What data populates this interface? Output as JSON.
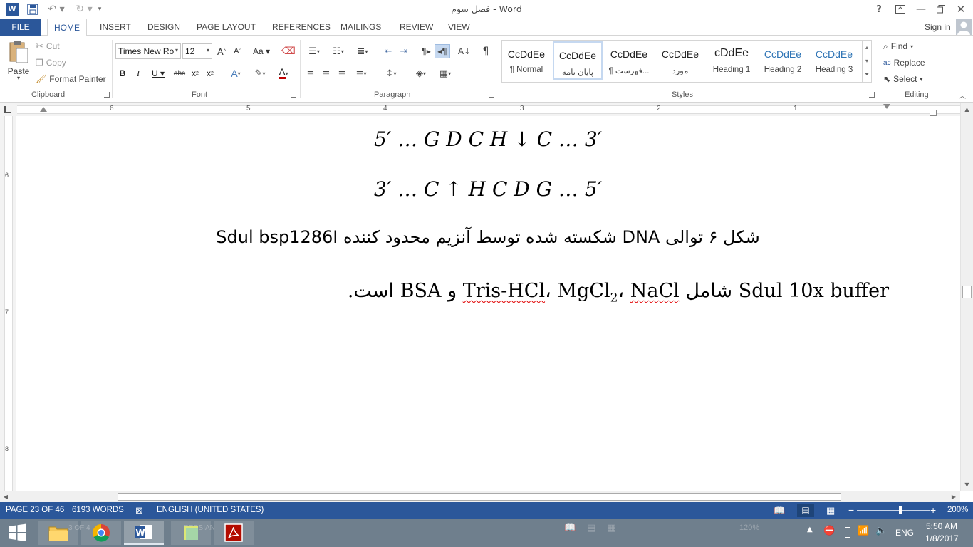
{
  "titlebar": {
    "title": "فصل سوم - Word",
    "help": "?",
    "signin": "Sign in"
  },
  "tabs": [
    "FILE",
    "HOME",
    "INSERT",
    "DESIGN",
    "PAGE LAYOUT",
    "REFERENCES",
    "MAILINGS",
    "REVIEW",
    "VIEW"
  ],
  "clipboard": {
    "paste": "Paste",
    "cut": "Cut",
    "copy": "Copy",
    "format_painter": "Format Painter",
    "label": "Clipboard"
  },
  "font": {
    "name": "Times New Ro",
    "size": "12",
    "label": "Font"
  },
  "paragraph": {
    "label": "Paragraph"
  },
  "styles": {
    "label": "Styles",
    "items": [
      {
        "sample": "CcDdEe",
        "name": "¶ Normal",
        "color": "#222"
      },
      {
        "sample": "CcDdEe",
        "name": "پایان نامه",
        "color": "#222"
      },
      {
        "sample": "CcDdEe",
        "name": "¶ فهرست...",
        "color": "#222"
      },
      {
        "sample": "CcDdEe",
        "name": "مورد",
        "color": "#222"
      },
      {
        "sample": "cDdEe",
        "name": "Heading 1",
        "color": "#222"
      },
      {
        "sample": "CcDdEe",
        "name": "Heading 2",
        "color": "#2e74b5"
      },
      {
        "sample": "CcDdEe",
        "name": "Heading 3",
        "color": "#2e74b5"
      }
    ]
  },
  "editing": {
    "find": "Find",
    "replace": "Replace",
    "select": "Select",
    "label": "Editing"
  },
  "ruler": {
    "numbers": [
      "6",
      "5",
      "4",
      "3",
      "2",
      "1"
    ],
    "vnumbers": [
      "6",
      "7",
      "8"
    ]
  },
  "document": {
    "eq1": "5′ … G D C H ↓ C … 3′",
    "eq2": "3′ … C ↑ H C D G … 5′",
    "caption": "شکل ۶ توالی DNA شکسته شده توسط آنزیم محدود کننده Sdul bsp1286I",
    "body_start": "Sdul 10x buffer شامل ",
    "body_trishcl": "Tris-HCl",
    "body_sep1": "، ",
    "body_mgcl": "MgCl",
    "body_sub": "2",
    "body_sep2": "، ",
    "body_nacl": "NaCl",
    "body_end": " و BSA است."
  },
  "status": {
    "page": "PAGE 23 OF 46",
    "words": "6193 WORDS",
    "language": "ENGLISH (UNITED STATES)",
    "zoom": "200%"
  },
  "taskbar": {
    "lang": "ENG",
    "time": "5:50 AM",
    "date": "1/8/2017",
    "ghost_zoom": "120%",
    "ghost_text1": "3 OF 4",
    "ghost_text2": "PERSIAN"
  }
}
